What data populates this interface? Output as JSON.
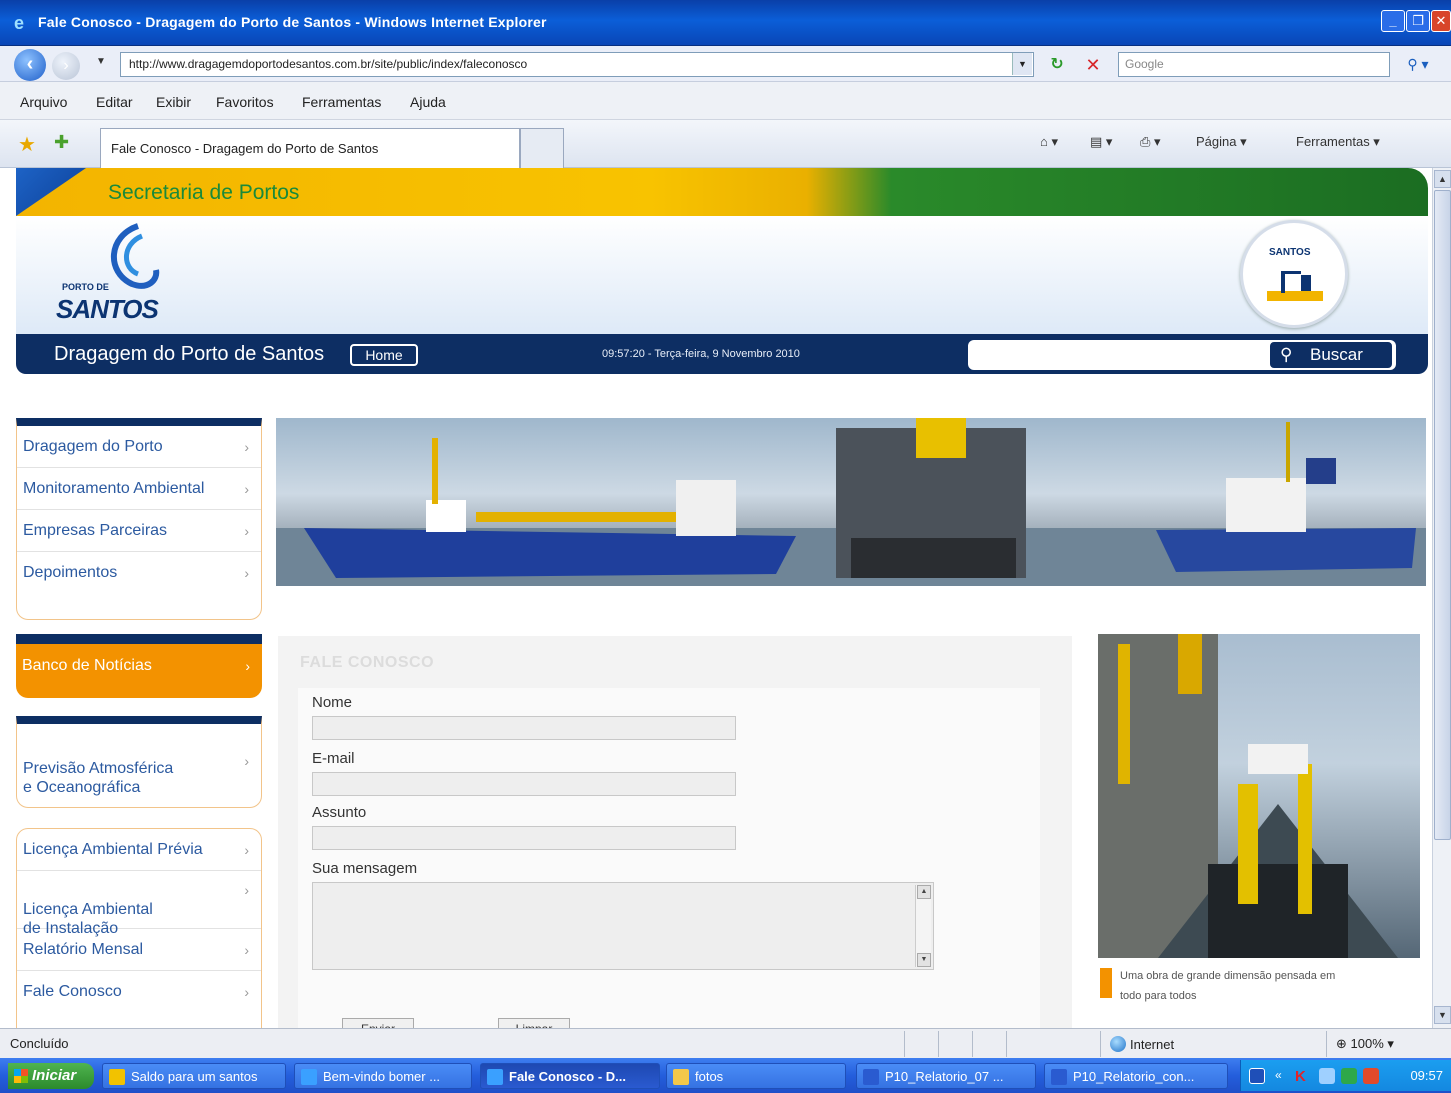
{
  "window": {
    "title": "Fale Conosco - Dragagem do Porto de Santos - Windows Internet Explorer",
    "min": "_",
    "max": "❐",
    "close": "✕"
  },
  "address": {
    "url": "http://www.dragagemdoportodesantos.com.br/site/public/index/faleconosco",
    "search_placeholder": "Google"
  },
  "menu": [
    "Arquivo",
    "Editar",
    "Exibir",
    "Favoritos",
    "Ferramentas",
    "Ajuda"
  ],
  "favbar": {
    "tab_title": "Fale Conosco - Dragagem do Porto de Santos",
    "page_label": "Página ▾",
    "tools_label": "Ferramentas ▾"
  },
  "site": {
    "secretaria": "Secretaria de Portos",
    "logo_small": "PORTO DE",
    "logo_text": "SANTOS",
    "badge_text": "SANTOS",
    "nav_title": "Dragagem do Porto de Santos",
    "home_label": "Home",
    "date_text": "09:57:20 - Terça-feira, 9 Novembro 2010",
    "search_button": "Buscar"
  },
  "sidebar": {
    "group1": [
      "Dragagem do Porto",
      "Monitoramento Ambiental",
      "Empresas Parceiras",
      "Depoimentos"
    ],
    "noticias": "Banco de Notícias",
    "group2": [
      "Previsão Atmosférica\ne Oceanográfica"
    ],
    "group3": [
      "Licença Ambiental Prévia",
      "Licença Ambiental\nde Instalação",
      "Relatório Mensal",
      "Fale Conosco"
    ],
    "chevron": "›"
  },
  "form": {
    "title": "FALE CONOSCO",
    "name_label": "Nome",
    "email_label": "E-mail",
    "subject_label": "Assunto",
    "message_label": "Sua mensagem",
    "send_label": "Enviar",
    "clear_label": "Limpar"
  },
  "photo": {
    "caption": "Uma obra de grande dimensão pensada em todo para todos"
  },
  "status": {
    "text": "Concluído",
    "zone": "Internet",
    "zoom": "100%"
  },
  "taskbar": {
    "start": "Iniciar",
    "items": [
      {
        "label": "Saldo para um santos",
        "color": "#f2c200"
      },
      {
        "label": "Bem-vindo bomer ...",
        "color": "#3aa0ff"
      },
      {
        "label": "Fale Conosco - D...",
        "color": "#3aa0ff"
      },
      {
        "label": "fotos",
        "color": "#f3c84a"
      },
      {
        "label": "P10_Relatorio_07 ...",
        "color": "#2a5bd0"
      },
      {
        "label": "P10_Relatorio_con...",
        "color": "#2a5bd0"
      }
    ],
    "time": "09:57"
  },
  "colors": {
    "navy": "#0d2e63",
    "orange": "#f39200",
    "green": "#1a8a3a",
    "link": "#2c5aa0"
  }
}
